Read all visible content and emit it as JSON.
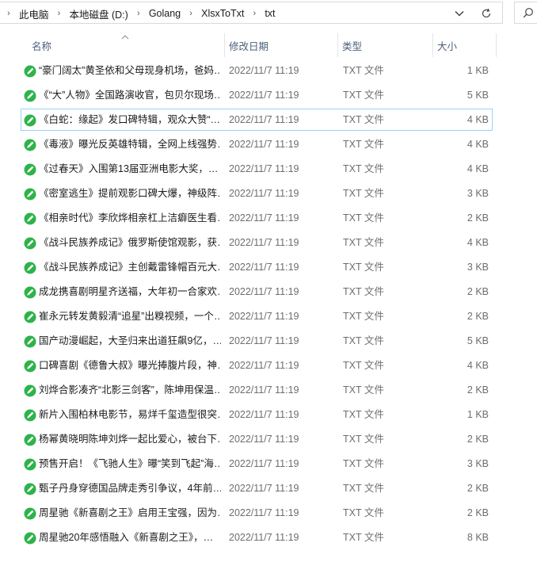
{
  "address_bar": {
    "crumbs": [
      "此电脑",
      "本地磁盘 (D:)",
      "Golang",
      "XlsxToTxt",
      "txt"
    ]
  },
  "columns": {
    "name": "名称",
    "date": "修改日期",
    "type": "类型",
    "size": "大小"
  },
  "colors": {
    "file_icon_green": "#2db34a",
    "focus_border": "#99d1ff",
    "header_text": "#4c607a"
  },
  "files": [
    {
      "name": "“豪门阔太”黄圣依和父母现身机场，爸妈…",
      "date": "2022/11/7 11:19",
      "type": "TXT 文件",
      "size": "1 KB"
    },
    {
      "name": "《“大”人物》全国路演收官，包贝尔现场…",
      "date": "2022/11/7 11:19",
      "type": "TXT 文件",
      "size": "5 KB"
    },
    {
      "name": "《白蛇：缘起》发口碑特辑，观众大赞“…",
      "date": "2022/11/7 11:19",
      "type": "TXT 文件",
      "size": "4 KB"
    },
    {
      "name": "《毒液》曝光反英雄特辑，全网上线强势…",
      "date": "2022/11/7 11:19",
      "type": "TXT 文件",
      "size": "4 KB"
    },
    {
      "name": "《过春天》入围第13届亚洲电影大奖，…",
      "date": "2022/11/7 11:19",
      "type": "TXT 文件",
      "size": "4 KB"
    },
    {
      "name": "《密室逃生》提前观影口碑大爆，神级阵…",
      "date": "2022/11/7 11:19",
      "type": "TXT 文件",
      "size": "3 KB"
    },
    {
      "name": "《相亲时代》李欣烨相亲杠上洁癖医生看…",
      "date": "2022/11/7 11:19",
      "type": "TXT 文件",
      "size": "2 KB"
    },
    {
      "name": "《战斗民族养成记》俄罗斯使馆观影，获…",
      "date": "2022/11/7 11:19",
      "type": "TXT 文件",
      "size": "4 KB"
    },
    {
      "name": "《战斗民族养成记》主创戴雷锋帽百元大…",
      "date": "2022/11/7 11:19",
      "type": "TXT 文件",
      "size": "3 KB"
    },
    {
      "name": "成龙携喜剧明星齐送福，大年初一合家欢…",
      "date": "2022/11/7 11:19",
      "type": "TXT 文件",
      "size": "2 KB"
    },
    {
      "name": "崔永元转发黄毅清“追星”出糗视频，一个…",
      "date": "2022/11/7 11:19",
      "type": "TXT 文件",
      "size": "2 KB"
    },
    {
      "name": "国产动漫崛起，大圣归来出道狂飙9亿，…",
      "date": "2022/11/7 11:19",
      "type": "TXT 文件",
      "size": "5 KB"
    },
    {
      "name": "口碑喜剧《德鲁大叔》曝光捧腹片段，神…",
      "date": "2022/11/7 11:19",
      "type": "TXT 文件",
      "size": "4 KB"
    },
    {
      "name": "刘烨合影凑齐“北影三剑客”，陈坤用保温…",
      "date": "2022/11/7 11:19",
      "type": "TXT 文件",
      "size": "2 KB"
    },
    {
      "name": "新片入围柏林电影节，易烊千玺造型很突…",
      "date": "2022/11/7 11:19",
      "type": "TXT 文件",
      "size": "1 KB"
    },
    {
      "name": "杨幂黄晓明陈坤刘烨一起比爱心，被台下…",
      "date": "2022/11/7 11:19",
      "type": "TXT 文件",
      "size": "2 KB"
    },
    {
      "name": "预售开启！《飞驰人生》曝“笑到飞起”海…",
      "date": "2022/11/7 11:19",
      "type": "TXT 文件",
      "size": "3 KB"
    },
    {
      "name": "甄子丹身穿德国品牌走秀引争议，4年前…",
      "date": "2022/11/7 11:19",
      "type": "TXT 文件",
      "size": "2 KB"
    },
    {
      "name": "周星驰《新喜剧之王》启用王宝强，因为…",
      "date": "2022/11/7 11:19",
      "type": "TXT 文件",
      "size": "2 KB"
    },
    {
      "name": "周星驰20年感悟融入《新喜剧之王》，…",
      "date": "2022/11/7 11:19",
      "type": "TXT 文件",
      "size": "8 KB"
    }
  ]
}
